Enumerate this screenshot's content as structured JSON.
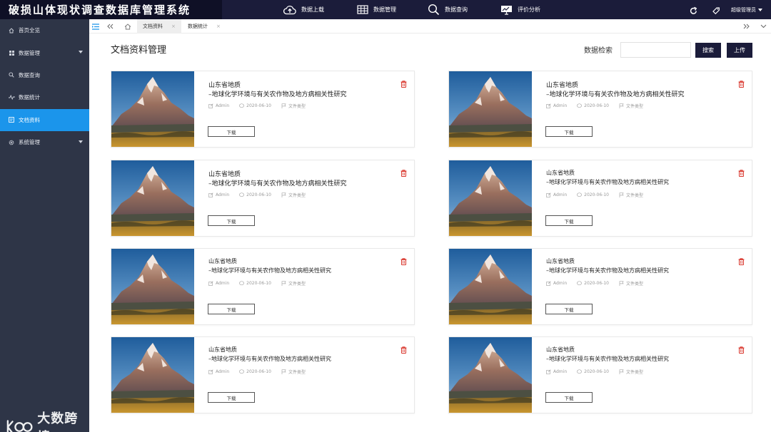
{
  "app": {
    "title": "破损山体现状调查数据库管理系统",
    "user": "超级管理员"
  },
  "topnav": [
    {
      "label": "数据上载",
      "icon": "cloud-upload-icon"
    },
    {
      "label": "数据管理",
      "icon": "table-grid-icon"
    },
    {
      "label": "数据查询",
      "icon": "search-icon"
    },
    {
      "label": "评价分析",
      "icon": "monitor-chart-icon"
    }
  ],
  "toolbar_icons": [
    "refresh-icon",
    "tag-icon"
  ],
  "sidebar": {
    "items": [
      {
        "label": "首页全览",
        "icon": "home-icon"
      },
      {
        "label": "数据管理",
        "icon": "grid-icon"
      },
      {
        "label": "数据查询",
        "icon": "search-icon"
      },
      {
        "label": "数据统计",
        "icon": "pulse-icon"
      },
      {
        "label": "文档资料",
        "icon": "document-icon"
      },
      {
        "label": "系统管理",
        "icon": "gear-icon"
      }
    ],
    "active": "文档资料"
  },
  "watermark": "大数跨境",
  "tabs": [
    {
      "label": "文档资料",
      "active": true
    },
    {
      "label": "数据统计",
      "active": false
    }
  ],
  "main": {
    "title": "文档资料管理",
    "search_label": "数据检索",
    "search_value": "",
    "search_button": "搜索",
    "upload_button": "上传"
  },
  "cards": [
    {
      "region": "山东省地质",
      "title": "–地球化学环境与有关农作物及地方病相关性研究",
      "author": "Admin",
      "date": "2020-06-10",
      "type": "文件类型",
      "download": "下载"
    },
    {
      "region": "山东省地质",
      "title": "–地球化学环境与有关农作物及地方病相关性研究",
      "author": "Admin",
      "date": "2020-06-10",
      "type": "文件类型",
      "download": "下载"
    },
    {
      "region": "山东省地质",
      "title": "–地球化学环境与有关农作物及地方病相关性研究",
      "author": "Admin",
      "date": "2020-06-10",
      "type": "文件类型",
      "download": "下载"
    },
    {
      "region": "山东省地质",
      "title": "–地球化学环境与有关农作物及地方病相关性研究",
      "author": "Admin",
      "date": "2020-06-10",
      "type": "文件类型",
      "download": "下载"
    },
    {
      "region": "山东省地质",
      "title": "–地球化学环境与有关农作物及地方病相关性研究",
      "author": "Admin",
      "date": "2020-06-10",
      "type": "文件类型",
      "download": "下载"
    },
    {
      "region": "山东省地质",
      "title": "–地球化学环境与有关农作物及地方病相关性研究",
      "author": "Admin",
      "date": "2020-06-10",
      "type": "文件类型",
      "download": "下载"
    },
    {
      "region": "山东省地质",
      "title": "–地球化学环境与有关农作物及地方病相关性研究",
      "author": "Admin",
      "date": "2020-06-10",
      "type": "文件类型",
      "download": "下载"
    },
    {
      "region": "山东省地质",
      "title": "–地球化学环境与有关农作物及地方病相关性研究",
      "author": "Admin",
      "date": "2020-06-10",
      "type": "文件类型",
      "download": "下载"
    }
  ],
  "colors": {
    "topbar": "#1b1c3a",
    "sidebar": "#2e3547",
    "active": "#1b95eb",
    "delete": "#d9352b"
  }
}
